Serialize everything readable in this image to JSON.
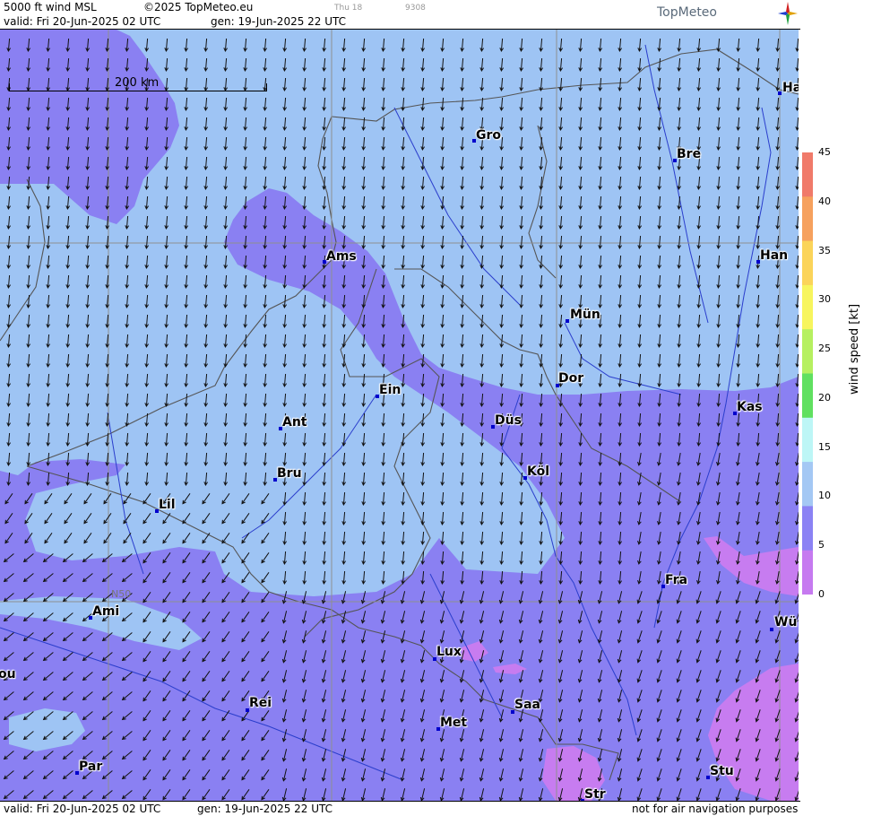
{
  "header": {
    "product": "5000 ft wind MSL",
    "copyright": "©2025 TopMeteo.eu",
    "small_day": "Thu 18",
    "small_code": "9308",
    "valid": "valid:  Fri  20-Jun-2025  02 UTC",
    "gen": "gen: 19-Jun-2025 22 UTC",
    "logo": "TopMeteo"
  },
  "footer": {
    "valid": "valid:  Fri  20-Jun-2025  02 UTC",
    "gen": "gen: 19-Jun-2025 22 UTC",
    "disclaimer": "not for air navigation purposes"
  },
  "map": {
    "scale_label": "200 km",
    "lat_label": "N50",
    "cities": [
      {
        "name": "Ha"
      },
      {
        "name": "Gro"
      },
      {
        "name": "Bre"
      },
      {
        "name": "Ams"
      },
      {
        "name": "Han"
      },
      {
        "name": "Mün"
      },
      {
        "name": "Dor"
      },
      {
        "name": "Ein"
      },
      {
        "name": "Kas"
      },
      {
        "name": "Ant"
      },
      {
        "name": "Düs"
      },
      {
        "name": "Köl"
      },
      {
        "name": "Bru"
      },
      {
        "name": "Lil"
      },
      {
        "name": "Fra"
      },
      {
        "name": "Ami"
      },
      {
        "name": "Wü"
      },
      {
        "name": "Lux"
      },
      {
        "name": "ou"
      },
      {
        "name": "Rei"
      },
      {
        "name": "Saa"
      },
      {
        "name": "Met"
      },
      {
        "name": "Stu"
      },
      {
        "name": "Par"
      },
      {
        "name": "Str"
      }
    ]
  },
  "legend": {
    "title": "wind speed [kt]",
    "ticks": [
      "45",
      "40",
      "35",
      "30",
      "25",
      "20",
      "15",
      "10",
      "5",
      "0"
    ],
    "colors": [
      "#f07a6a",
      "#f6a15e",
      "#fbd45a",
      "#f7f55e",
      "#b6f060",
      "#60e060",
      "#bdf6f6",
      "#a4c8f4",
      "#8b82f4",
      "#c67af0"
    ]
  },
  "colors": {
    "light_blue": "#9ec4f4",
    "purple": "#8a80f2",
    "violet": "#c77cf0",
    "border": "#555555",
    "river": "#2b3ecc",
    "city_dot": "#0000cc"
  }
}
